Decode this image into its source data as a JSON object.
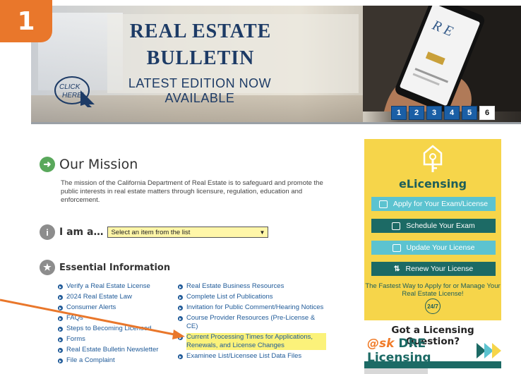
{
  "step_badge": "1",
  "banner": {
    "title_line1": "REAL ESTATE",
    "title_line2": "BULLETIN",
    "subtitle": "LATEST EDITION NOW AVAILABLE",
    "click_here": "CLICK HERE!",
    "slides": [
      "1",
      "2",
      "3",
      "4",
      "5",
      "6"
    ],
    "active_slide": "6"
  },
  "mission": {
    "title": "Our Mission",
    "text": "The mission of the California Department of Real Estate is to safeguard and promote the public interests in real estate matters through licensure, regulation, education and enforcement."
  },
  "iam": {
    "label": "I am a…",
    "select_value": "Select an item from the list"
  },
  "essential": {
    "title": "Essential Information",
    "col1": [
      "Verify a Real Estate License",
      "2024 Real Estate Law",
      "Consumer Alerts",
      "FAQs",
      "Steps to Becoming Licensed",
      "Forms",
      "Real Estate Bulletin Newsletter",
      "File a Complaint"
    ],
    "col2": [
      "Real Estate Business Resources",
      "Complete List of Publications",
      "Invitation for Public Comment/Hearing Notices",
      "Course Provider Resources (Pre-License & CE)",
      "Current Processing Times for Applications, Renewals, and License Changes",
      "Examinee List/Licensee List Data Files"
    ]
  },
  "sidebar": {
    "title": "eLicensing",
    "buttons": [
      "Apply for Your Exam/License",
      "Schedule Your Exam",
      "Update Your License",
      "Renew Your License"
    ],
    "tagline": "The Fastest Way to Apply for or Manage Your Real Estate License!",
    "badge_247": "24/7",
    "question": "Got a Licensing Question?",
    "ask_prefix": "@sk",
    "ask_brand": "DRE Licensing"
  },
  "colors": {
    "accent_orange": "#e9772b",
    "link_blue": "#1f5a98",
    "elicensing_yellow": "#f6d54a",
    "teal_dark": "#1c6a65",
    "teal_light": "#5cc3d0",
    "highlight": "#fbf27a"
  }
}
